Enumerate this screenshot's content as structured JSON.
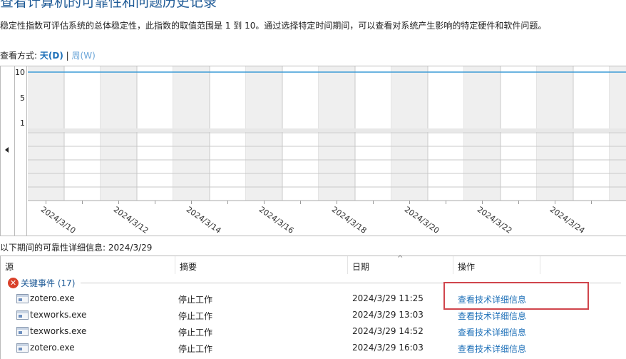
{
  "header": {
    "title": "查看计算机的可靠性和问题历史记录",
    "description": "稳定性指数可评估系统的总体稳定性，此指数的取值范围是 1 到 10。通过选择特定时间期间，可以查看对系统产生影响的特定硬件和软件问题。"
  },
  "view_by": {
    "label": "查看方式:",
    "day": "天(D)",
    "separator": "|",
    "week": "周(W)"
  },
  "chart_data": {
    "type": "line",
    "title": "",
    "ylim": [
      1,
      10
    ],
    "y_ticks": [
      "10",
      "5",
      "1"
    ],
    "x_labels": [
      "2024/3/10",
      "2024/3/12",
      "2024/3/14",
      "2024/3/16",
      "2024/3/18",
      "2024/3/20",
      "2024/3/22",
      "2024/3/24"
    ],
    "days_visible": 17,
    "series": [
      {
        "name": "稳定性指数",
        "values": [
          10,
          10,
          10,
          10,
          10,
          10,
          10,
          10,
          10,
          10,
          10,
          10,
          10,
          10,
          10,
          10,
          10
        ]
      }
    ],
    "event_rows": 5,
    "colors": {
      "line": "#3c9bd6",
      "shade": "#efefef",
      "grid": "#c9c9c9"
    }
  },
  "details": {
    "label": "以下期间的可靠性详细信息: 2024/3/29"
  },
  "table": {
    "columns": [
      "源",
      "摘要",
      "日期",
      "操作"
    ],
    "group": {
      "label": "关键事件 (17)"
    },
    "rows": [
      {
        "source": "zotero.exe",
        "summary": "停止工作",
        "date": "2024/3/29 11:25",
        "action": "查看技术详细信息"
      },
      {
        "source": "texworks.exe",
        "summary": "停止工作",
        "date": "2024/3/29 13:03",
        "action": "查看技术详细信息"
      },
      {
        "source": "texworks.exe",
        "summary": "停止工作",
        "date": "2024/3/29 14:52",
        "action": "查看技术详细信息"
      },
      {
        "source": "zotero.exe",
        "summary": "停止工作",
        "date": "2024/3/29 16:03",
        "action": "查看技术详细信息"
      }
    ]
  }
}
